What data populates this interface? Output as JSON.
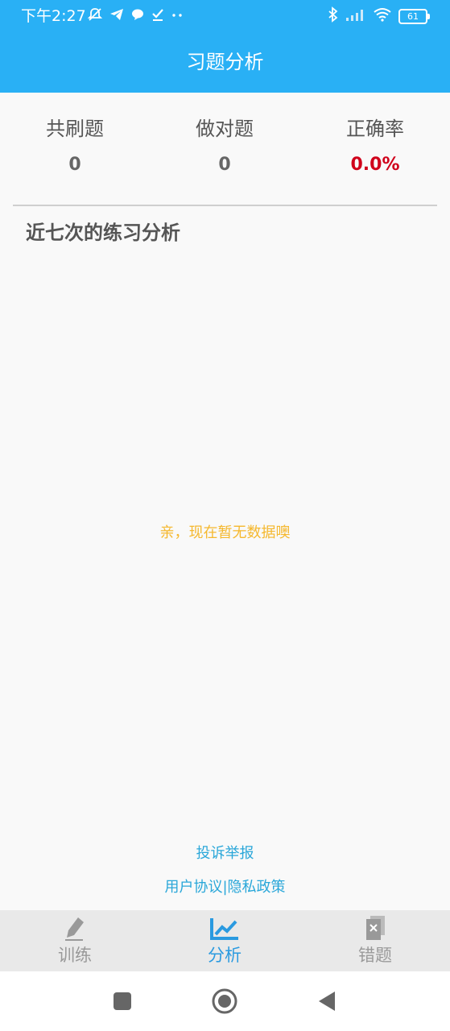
{
  "status_bar": {
    "time": "下午2:27",
    "battery": "61",
    "left_icons": [
      "mute-bell-icon",
      "telegram-icon",
      "chat-bubble-icon",
      "check-icon",
      "more-dots-icon"
    ],
    "right_icons": [
      "bluetooth-icon",
      "signal-icon",
      "wifi-icon",
      "battery-icon"
    ]
  },
  "header": {
    "title": "习题分析"
  },
  "stats": {
    "total_label": "共刷题",
    "total_value": "0",
    "correct_label": "做对题",
    "correct_value": "0",
    "accuracy_label": "正确率",
    "accuracy_value": "0.0%",
    "accuracy_color": "#d0021b"
  },
  "analysis": {
    "title": "近七次的练习分析",
    "empty_message": "亲，现在暂无数据噢"
  },
  "footer_links": {
    "report": "投诉举报",
    "user_agreement": "用户协议",
    "separator": "|",
    "privacy_policy": "隐私政策"
  },
  "tabs": [
    {
      "label": "训练",
      "icon": "pencil-icon",
      "active": false
    },
    {
      "label": "分析",
      "icon": "chart-icon",
      "active": true
    },
    {
      "label": "错题",
      "icon": "wrong-doc-icon",
      "active": false
    }
  ],
  "colors": {
    "primary": "#29b0f5",
    "link": "#2aa7d9",
    "empty_text": "#f5b82e",
    "tab_active": "#2a9ae0"
  }
}
